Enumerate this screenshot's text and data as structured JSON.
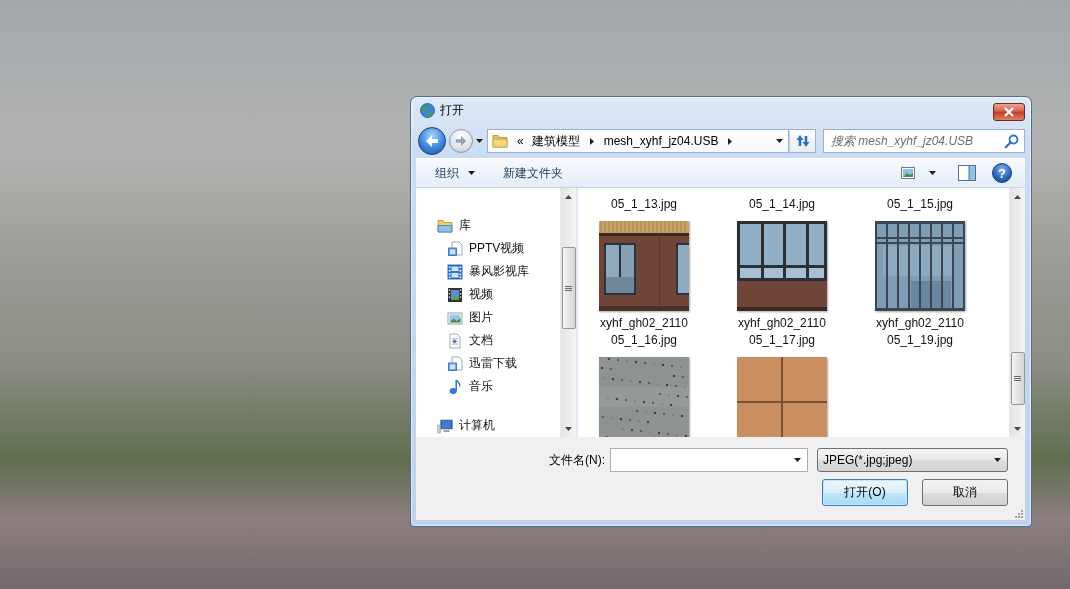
{
  "window": {
    "title": "打开"
  },
  "navigation": {
    "back": {
      "disabled": false
    },
    "forward": {
      "disabled": true
    }
  },
  "address_bar": {
    "overflow": "«",
    "path": [
      "建筑模型",
      "mesh_xyhf_jz04.USB"
    ]
  },
  "search": {
    "placeholder": "搜索 mesh_xyhf_jz04.USB"
  },
  "toolbar": {
    "items": [
      {
        "kind": "menu",
        "label": "组织"
      },
      {
        "kind": "command",
        "label": "新建文件夹"
      }
    ],
    "help": "?"
  },
  "nav_pane": {
    "items": [
      {
        "kind": "libraries",
        "label": "库",
        "selected": false,
        "children": [
          {
            "kind": "library",
            "label": "PPTV视频",
            "selected": false
          },
          {
            "kind": "media-library",
            "label": "暴风影视库",
            "selected": false
          },
          {
            "kind": "videos",
            "label": "视频",
            "selected": false
          },
          {
            "kind": "pictures",
            "label": "图片",
            "selected": false
          },
          {
            "kind": "documents",
            "label": "文档",
            "selected": false
          },
          {
            "kind": "library",
            "label": "迅雷下载",
            "selected": false
          },
          {
            "kind": "music",
            "label": "音乐",
            "selected": false
          }
        ]
      },
      {
        "kind": "computer",
        "label": "计算机",
        "selected": false
      }
    ]
  },
  "files": [
    {
      "name": "05_1_13.jpg",
      "selected": false
    },
    {
      "name": "05_1_14.jpg",
      "selected": false
    },
    {
      "name": "05_1_15.jpg",
      "selected": false
    },
    {
      "kind": "wall",
      "name": "xyhf_gh02_2110\n05_1_16.jpg",
      "selected": false
    },
    {
      "kind": "window",
      "name": "xyhf_gh02_2110\n05_1_17.jpg",
      "selected": false
    },
    {
      "kind": "glass",
      "name": "xyhf_gh02_2110\n05_1_19.jpg",
      "selected": false
    },
    {
      "kind": "concrete",
      "selected": false
    },
    {
      "kind": "tile",
      "selected": false
    }
  ],
  "footer": {
    "filename_label": "文件名(N):",
    "file_type": "JPEG(*.jpg;jpeg)",
    "buttons": [
      {
        "label": "打开(O)",
        "default": true
      },
      {
        "label": "取消",
        "default": false
      }
    ]
  }
}
